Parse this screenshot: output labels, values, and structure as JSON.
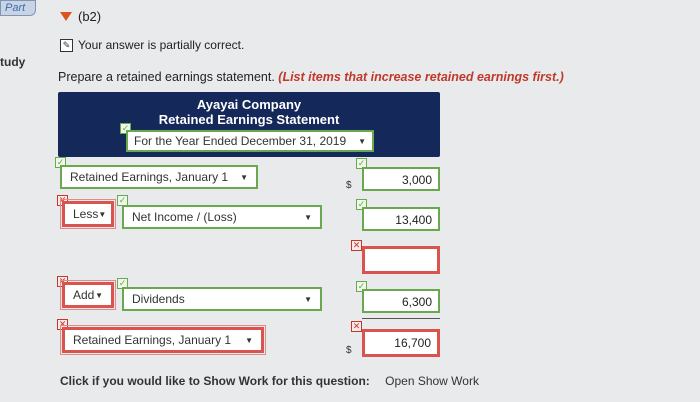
{
  "sidebar": {
    "part_tab": "Part",
    "study_label": "tudy"
  },
  "section": {
    "label": "(b2)"
  },
  "status": {
    "text": "Your answer is partially correct."
  },
  "prompt": {
    "text": "Prepare a retained earnings statement.",
    "hint": "(List items that increase retained earnings first.)"
  },
  "statement": {
    "company": "Ayayai Company",
    "title": "Retained Earnings Statement",
    "period": "For the Year Ended December 31, 2019"
  },
  "rows": [
    {
      "label": "Retained Earnings, January 1",
      "value": "3,000"
    },
    {
      "operator": "Less",
      "label": "Net Income / (Loss)",
      "value": "13,400"
    },
    {
      "value": ""
    },
    {
      "operator": "Add",
      "label": "Dividends",
      "value": "6,300"
    },
    {
      "label": "Retained Earnings, January 1",
      "value": "16,700"
    }
  ],
  "currency_symbol": "$",
  "footer": {
    "prompt": "Click if you would like to Show Work for this question:",
    "link": "Open Show Work"
  }
}
